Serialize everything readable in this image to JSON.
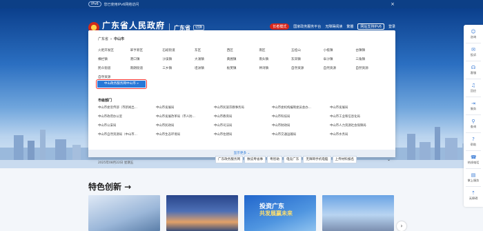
{
  "topstrip": {
    "ipv6": "IPv6",
    "message": "您已使用IPv6网络访问",
    "close": "×"
  },
  "header": {
    "title": "广东省人民政府",
    "subtitle": "People's Government of Guangdong Province",
    "province": "广东省",
    "switch": "切换",
    "links": [
      "长者模式",
      "国家政务服务平台",
      "无障碍阅读",
      "繁體",
      "网站支持IPv6",
      "登录"
    ]
  },
  "dropdown": {
    "crumb": {
      "parent": "广东省",
      "current": "中山市"
    },
    "towns": [
      "火炬开发区",
      "翠亨新区",
      "石岐街道",
      "东区",
      "西区",
      "南区",
      "五桂山",
      "小榄镇",
      "古镇镇",
      "横栏镇",
      "港口镇",
      "沙溪镇",
      "大涌镇",
      "黄圃镇",
      "南头镇",
      "东凤镇",
      "阜沙镇",
      "三角镇",
      "民众街道",
      "南朗街道",
      "三乡镇",
      "坦洲镇",
      "板芙镇",
      "神湾镇",
      "自然资源",
      "自然资源",
      "自然资源",
      "自然资源"
    ],
    "highlight_button": "中山政务服务网中山市 »",
    "dept_title": "市级部门",
    "depts": [
      "中山市委宣传部（市新闻出...",
      "中山市发展局",
      "中山市民族宗教事务局",
      "中山市委机构编制委员会办...",
      "中山市发展局",
      "中山市政府办公室",
      "中山市发展改革局（市人防...",
      "中山市教育局",
      "中山市科技局",
      "中山市工业和信息化局",
      "中山市公安局",
      "中山市民政局",
      "中山市司法局",
      "中山市财政局",
      "中山市人力资源社会保障局",
      "中山市自然资源局（中山市...",
      "中山市生态环境局",
      "中山市住建局",
      "中山市交通运输局",
      "中山市水务局"
    ],
    "more": "显示更多 ⌄"
  },
  "hero_bottom": {
    "date": "2025年08月22日 星期五",
    "buttons": [
      "广东政务服务网",
      "数说粤省事",
      "粤智助",
      "电竞广东",
      "无障碍手机电脑",
      "上传材料报名"
    ]
  },
  "section": {
    "title": "特色创新 →",
    "card3_line1": "投资广东",
    "card3_line2": "共发展赢未来"
  },
  "sidebar": [
    {
      "icon": "☺",
      "label": "咨询"
    },
    {
      "icon": "✉",
      "label": "投诉"
    },
    {
      "icon": "☊",
      "label": "客服"
    },
    {
      "icon": "♫",
      "label": "回应"
    },
    {
      "icon": "⇥",
      "label": "服务"
    },
    {
      "icon": "⚲",
      "label": "查询"
    },
    {
      "icon": "?",
      "label": "帮助"
    },
    {
      "icon": "☎",
      "label": "热线电话"
    },
    {
      "icon": "▤",
      "label": "掌上服务"
    },
    {
      "icon": "⇡",
      "label": "无障碍"
    }
  ],
  "colors": {
    "brand_blue": "#0c3f86",
    "accent_blue": "#2878d8",
    "alert_red": "#d6261c"
  }
}
